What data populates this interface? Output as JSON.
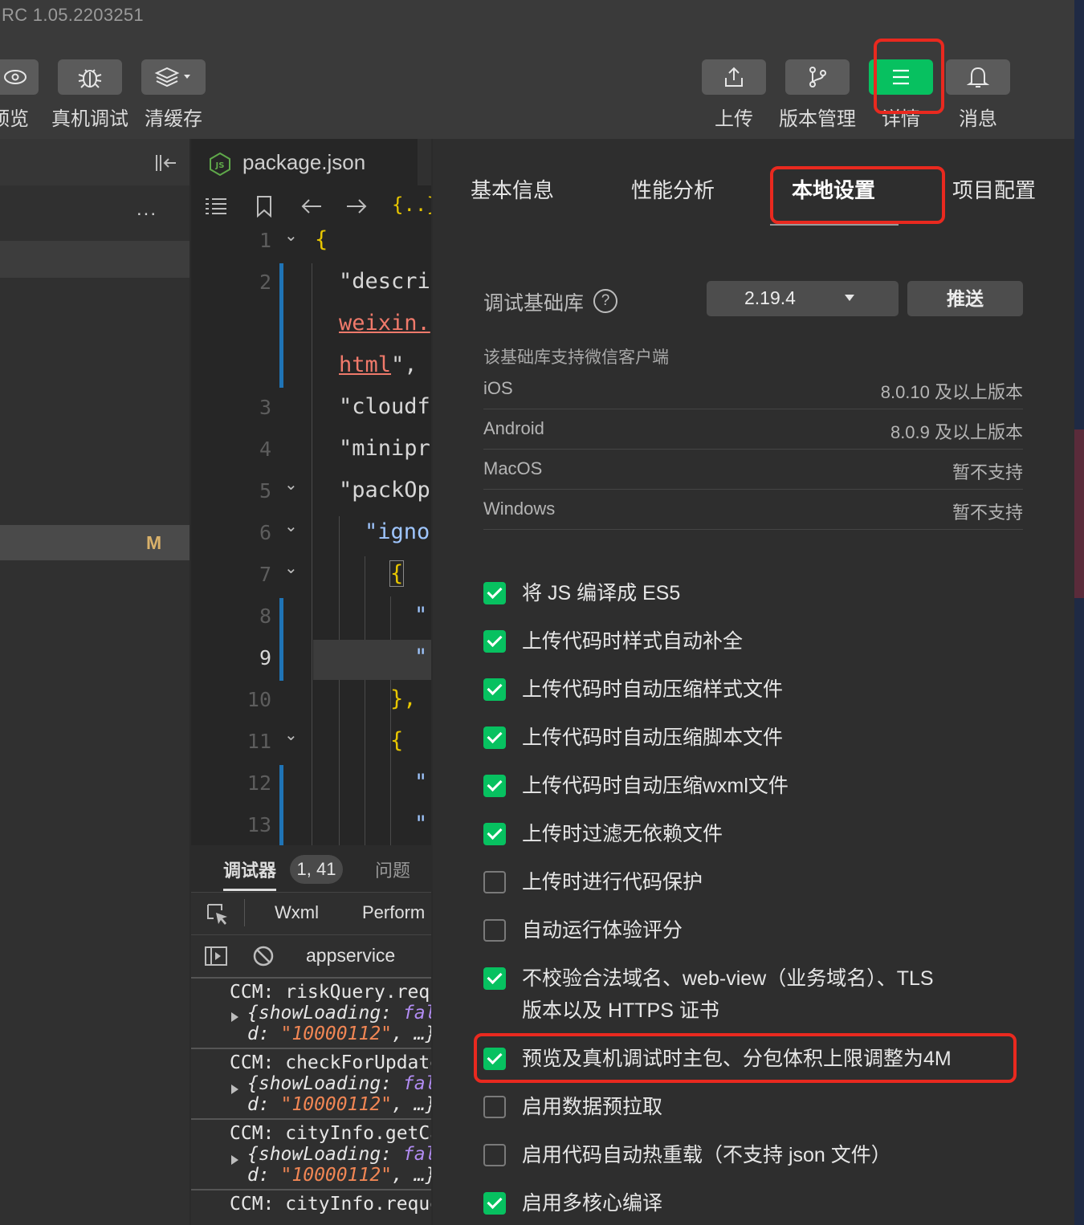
{
  "app": {
    "version": "RC 1.05.2203251"
  },
  "toolbar": {
    "left": [
      {
        "name": "preview",
        "label": "预览",
        "icon": "eye-icon"
      },
      {
        "name": "remote-debug",
        "label": "真机调试",
        "icon": "bug-icon"
      },
      {
        "name": "clear-cache",
        "label": "清缓存",
        "icon": "layers-icon"
      }
    ],
    "right": [
      {
        "name": "upload",
        "label": "上传",
        "icon": "upload-icon"
      },
      {
        "name": "version-mgmt",
        "label": "版本管理",
        "icon": "branch-icon"
      },
      {
        "name": "details",
        "label": "详情",
        "icon": "menu-icon",
        "active": true
      },
      {
        "name": "messages",
        "label": "消息",
        "icon": "bell-icon"
      }
    ]
  },
  "left_panel": {
    "more": "...",
    "badge": "M"
  },
  "editor": {
    "file_tab": "package.json",
    "file_icon_text": "JS",
    "lines": [
      {
        "n": "1",
        "text": "{"
      },
      {
        "n": "2",
        "text": "\"descri"
      },
      {
        "n": "",
        "text": "weixin."
      },
      {
        "n": "",
        "text": "html\","
      },
      {
        "n": "3",
        "text": "\"cloudf"
      },
      {
        "n": "4",
        "text": "\"minipr"
      },
      {
        "n": "5",
        "text": "\"packOp"
      },
      {
        "n": "6",
        "text": "\"igno"
      },
      {
        "n": "7",
        "text": "{"
      },
      {
        "n": "8",
        "text": "\"."
      },
      {
        "n": "9",
        "text": "\"."
      },
      {
        "n": "10",
        "text": "},"
      },
      {
        "n": "11",
        "text": "{"
      },
      {
        "n": "12",
        "text": "\"."
      },
      {
        "n": "13",
        "text": "\"."
      }
    ]
  },
  "debugger": {
    "tabs": [
      "调试器",
      "问题"
    ],
    "badge": "1, 41",
    "subtabs": [
      "Wxml",
      "Perform"
    ],
    "context": "appservice",
    "entries": [
      {
        "head": "CCM: riskQuery.requ",
        "l2a": "{showLoading: ",
        "l2b": "fal",
        "l3a": "d: ",
        "l3b": "\"10000112\"",
        "l3c": ", …}"
      },
      {
        "head": "CCM: checkForUpdate",
        "l2a": "{showLoading: ",
        "l2b": "fal",
        "l3a": "d: ",
        "l3b": "\"10000112\"",
        "l3c": ", …}"
      },
      {
        "head": "CCM: cityInfo.getCa",
        "l2a": "{showLoading: ",
        "l2b": "fal",
        "l3a": "d: ",
        "l3b": "\"10000112\"",
        "l3c": ", …}"
      },
      {
        "head": "CCM: cityInfo.reque"
      }
    ]
  },
  "settings": {
    "tabs": [
      "基本信息",
      "性能分析",
      "本地设置",
      "项目配置"
    ],
    "selected_tab": "本地设置",
    "lib_label": "调试基础库",
    "lib_version": "2.19.4",
    "push_label": "推送",
    "support_text": "该基础库支持微信客户端",
    "platforms": [
      {
        "name": "iOS",
        "value": "8.0.10 及以上版本"
      },
      {
        "name": "Android",
        "value": "8.0.9 及以上版本"
      },
      {
        "name": "MacOS",
        "value": "暂不支持"
      },
      {
        "name": "Windows",
        "value": "暂不支持"
      }
    ],
    "options": [
      {
        "label": "将 JS 编译成 ES5",
        "checked": true
      },
      {
        "label": "上传代码时样式自动补全",
        "checked": true
      },
      {
        "label": "上传代码时自动压缩样式文件",
        "checked": true
      },
      {
        "label": "上传代码时自动压缩脚本文件",
        "checked": true
      },
      {
        "label": "上传代码时自动压缩wxml文件",
        "checked": true
      },
      {
        "label": "上传时过滤无依赖文件",
        "checked": true
      },
      {
        "label": "上传时进行代码保护",
        "checked": false
      },
      {
        "label": "自动运行体验评分",
        "checked": false
      },
      {
        "label": "不校验合法域名、web-view（业务域名）、TLS",
        "label2": "版本以及 HTTPS 证书",
        "checked": true
      },
      {
        "label": "预览及真机调试时主包、分包体积上限调整为4M",
        "checked": true,
        "highlight": true
      },
      {
        "label": "启用数据预拉取",
        "checked": false
      },
      {
        "label": "启用代码自动热重载（不支持 json 文件）",
        "checked": false
      },
      {
        "label": "启用多核心编译",
        "checked": true
      }
    ]
  },
  "colors": {
    "accent": "#07c160",
    "highlight": "#e9291f"
  }
}
